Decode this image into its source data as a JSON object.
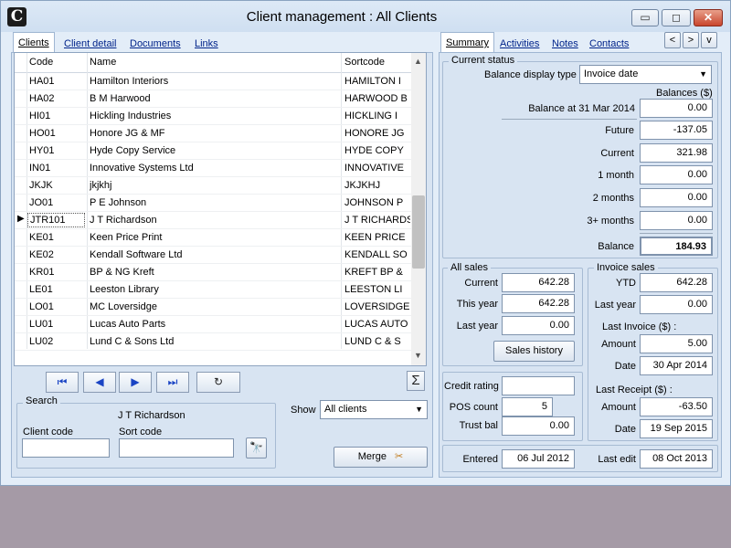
{
  "window": {
    "title": "Client management : All Clients",
    "logo_letter": "C",
    "minimize_glyph": "▭",
    "maximize_glyph": "◻",
    "close_glyph": "✕"
  },
  "left_tabs": [
    "Clients",
    "Client detail",
    "Documents",
    "Links"
  ],
  "grid": {
    "headers": [
      "Code",
      "Name",
      "Sortcode"
    ],
    "rows": [
      {
        "code": "HA01",
        "name": "Hamilton Interiors",
        "sort": "HAMILTON I"
      },
      {
        "code": "HA02",
        "name": "B M Harwood",
        "sort": "HARWOOD B"
      },
      {
        "code": "HI01",
        "name": "Hickling Industries",
        "sort": "HICKLING I"
      },
      {
        "code": "HO01",
        "name": "Honore JG & MF",
        "sort": "HONORE JG"
      },
      {
        "code": "HY01",
        "name": "Hyde Copy Service",
        "sort": "HYDE COPY"
      },
      {
        "code": "IN01",
        "name": "Innovative Systems Ltd",
        "sort": "INNOVATIVE"
      },
      {
        "code": "JKJK",
        "name": "jkjkhj",
        "sort": "JKJKHJ"
      },
      {
        "code": "JO01",
        "name": "P E Johnson",
        "sort": "JOHNSON P"
      },
      {
        "code": "JTR101",
        "name": "J T Richardson",
        "sort": "J T RICHARDS"
      },
      {
        "code": "KE01",
        "name": "Keen Price Print",
        "sort": "KEEN PRICE"
      },
      {
        "code": "KE02",
        "name": "Kendall Software Ltd",
        "sort": "KENDALL SO"
      },
      {
        "code": "KR01",
        "name": "BP & NG Kreft",
        "sort": "KREFT BP &"
      },
      {
        "code": "LE01",
        "name": "Leeston Library",
        "sort": "LEESTON LI"
      },
      {
        "code": "LO01",
        "name": "MC Loversidge",
        "sort": "LOVERSIDGE"
      },
      {
        "code": "LU01",
        "name": "Lucas Auto Parts",
        "sort": "LUCAS AUTO"
      },
      {
        "code": "LU02",
        "name": "Lund C & Sons Ltd",
        "sort": "LUND C & S"
      }
    ],
    "selected_index": 8,
    "scroll_up": "▲",
    "scroll_down": "▼"
  },
  "nav": {
    "first": "⏮",
    "prev": "◀",
    "next": "▶",
    "last": "⏭",
    "refresh": "↻",
    "sum": "Σ"
  },
  "search": {
    "title": "Search",
    "selected_name": "J T Richardson",
    "client_code_label": "Client code",
    "client_code_value": "",
    "sort_code_label": "Sort code",
    "sort_code_value": "",
    "binoculars": "🔭"
  },
  "show": {
    "label": "Show",
    "value": "All clients"
  },
  "merge": {
    "label": "Merge"
  },
  "right_tabs": [
    "Summary",
    "Activities",
    "Notes",
    "Contacts"
  ],
  "right_nav": {
    "back": "<",
    "forward": ">",
    "down": "v"
  },
  "current_status": {
    "title": "Current status",
    "balance_display_label": "Balance display type",
    "balance_display_value": "Invoice date",
    "balances_header": "Balances ($)",
    "balance_at_label": "Balance at 31 Mar 2014",
    "balance_at": "0.00",
    "future_label": "Future",
    "future": "-137.05",
    "current_label": "Current",
    "current": "321.98",
    "m1_label": "1 month",
    "m1": "0.00",
    "m2_label": "2 months",
    "m2": "0.00",
    "m3_label": "3+ months",
    "m3": "0.00",
    "balance_label": "Balance",
    "balance": "184.93"
  },
  "all_sales": {
    "title": "All sales",
    "current_label": "Current",
    "current": "642.28",
    "this_year_label": "This year",
    "this_year": "642.28",
    "last_year_label": "Last year",
    "last_year": "0.00",
    "history_button": "Sales history"
  },
  "invoice_sales": {
    "title": "Invoice sales",
    "ytd_label": "YTD",
    "ytd": "642.28",
    "last_year_label": "Last year",
    "last_year": "0.00",
    "last_invoice_label": "Last Invoice ($) :",
    "amount_label": "Amount",
    "amount": "5.00",
    "date_label": "Date",
    "date": "30 Apr 2014",
    "last_receipt_label": "Last Receipt ($) :",
    "receipt_amount_label": "Amount",
    "receipt_amount": "-63.50",
    "receipt_date_label": "Date",
    "receipt_date": "19 Sep 2015"
  },
  "credit": {
    "rating_label": "Credit rating",
    "rating": "",
    "pos_label": "POS count",
    "pos": "5",
    "trust_label": "Trust bal",
    "trust": "0.00"
  },
  "footer": {
    "entered_label": "Entered",
    "entered": "06 Jul 2012",
    "last_edit_label": "Last edit",
    "last_edit": "08 Oct 2013"
  }
}
